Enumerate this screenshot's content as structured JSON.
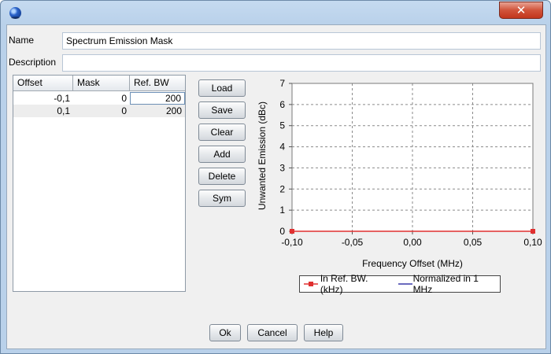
{
  "window": {
    "close_glyph": "✕"
  },
  "form": {
    "name_label": "Name",
    "name_value": "Spectrum Emission Mask",
    "description_label": "Description",
    "description_value": ""
  },
  "table": {
    "headers": [
      "Offset",
      "Mask",
      "Ref. BW"
    ],
    "rows": [
      [
        "-0,1",
        "0",
        "200"
      ],
      [
        "0,1",
        "0",
        "200"
      ]
    ]
  },
  "side_buttons": {
    "load": "Load",
    "save": "Save",
    "clear": "Clear",
    "add": "Add",
    "delete": "Delete",
    "sym": "Sym"
  },
  "chart_data": {
    "type": "line",
    "xlabel": "Frequency Offset (MHz)",
    "ylabel": "Unwanted Emission (dBc)",
    "x_ticks": [
      "-0,10",
      "-0,05",
      "0,00",
      "0,05",
      "0,10"
    ],
    "y_ticks": [
      "0",
      "1",
      "2",
      "3",
      "4",
      "5",
      "6",
      "7"
    ],
    "xlim": [
      -0.1,
      0.1
    ],
    "ylim": [
      0,
      7
    ],
    "grid": true,
    "legend_position": "bottom",
    "series": [
      {
        "name": "In Ref. BW. (kHz)",
        "color": "#e03030",
        "marker": "square",
        "x": [
          -0.1,
          0.1
        ],
        "y": [
          0,
          0
        ]
      },
      {
        "name": "Normalized in 1 MHz",
        "color": "#3a3aa8",
        "marker": "none",
        "x": [],
        "y": []
      }
    ]
  },
  "bottom_buttons": {
    "ok": "Ok",
    "cancel": "Cancel",
    "help": "Help"
  }
}
